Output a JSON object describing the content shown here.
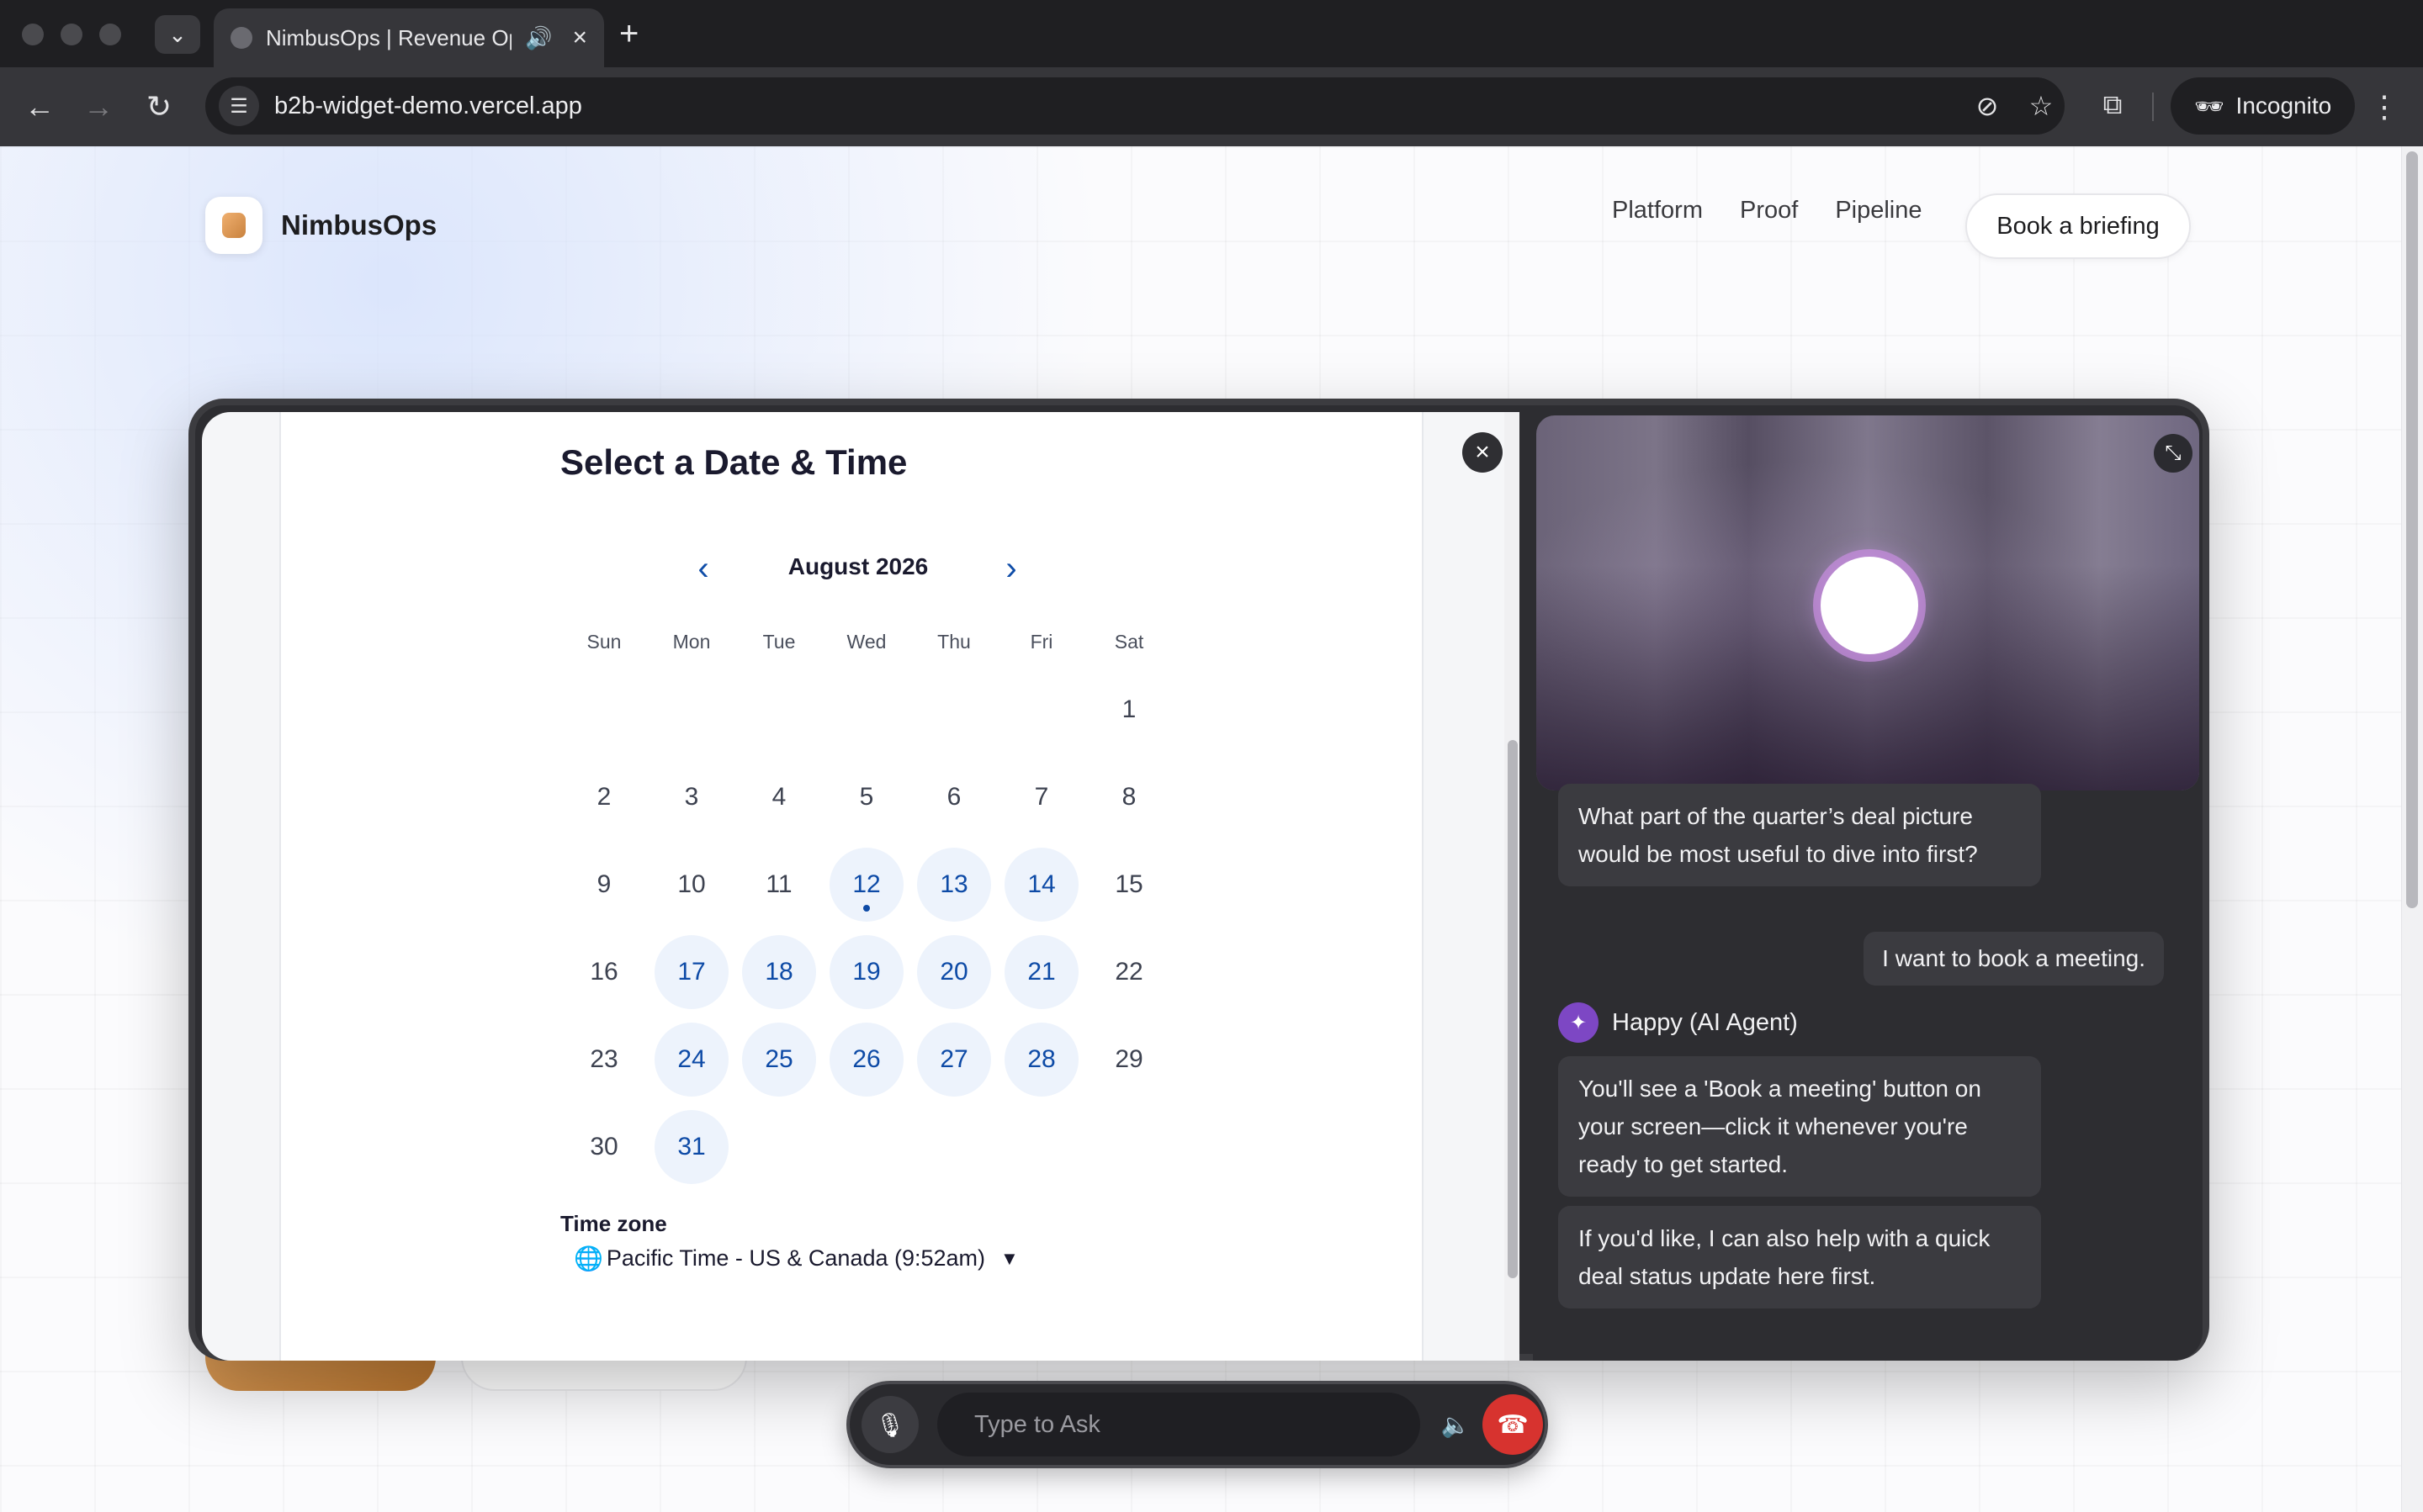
{
  "browser": {
    "tab_title": "NimbusOps | Revenue Op",
    "tab_audio_icon": "speaker-icon",
    "url": "b2b-widget-demo.vercel.app",
    "profile_label": "Incognito"
  },
  "site": {
    "brand_name": "NimbusOps",
    "nav": [
      {
        "label": "Platform"
      },
      {
        "label": "Proof"
      },
      {
        "label": "Pipeline"
      }
    ],
    "cta_label": "Book a briefing"
  },
  "calendar": {
    "title": "Select a Date & Time",
    "month_label": "August 2026",
    "weekdays": [
      "Sun",
      "Mon",
      "Tue",
      "Wed",
      "Thu",
      "Fri",
      "Sat"
    ],
    "first_weekday_index": 6,
    "days": [
      {
        "n": "1",
        "available": false
      },
      {
        "n": "2",
        "available": false
      },
      {
        "n": "3",
        "available": false
      },
      {
        "n": "4",
        "available": false
      },
      {
        "n": "5",
        "available": false
      },
      {
        "n": "6",
        "available": false
      },
      {
        "n": "7",
        "available": false
      },
      {
        "n": "8",
        "available": false
      },
      {
        "n": "9",
        "available": false
      },
      {
        "n": "10",
        "available": false
      },
      {
        "n": "11",
        "available": false
      },
      {
        "n": "12",
        "available": true,
        "today": true
      },
      {
        "n": "13",
        "available": true
      },
      {
        "n": "14",
        "available": true
      },
      {
        "n": "15",
        "available": false
      },
      {
        "n": "16",
        "available": false
      },
      {
        "n": "17",
        "available": true
      },
      {
        "n": "18",
        "available": true
      },
      {
        "n": "19",
        "available": true
      },
      {
        "n": "20",
        "available": true
      },
      {
        "n": "21",
        "available": true
      },
      {
        "n": "22",
        "available": false
      },
      {
        "n": "23",
        "available": false
      },
      {
        "n": "24",
        "available": true
      },
      {
        "n": "25",
        "available": true
      },
      {
        "n": "26",
        "available": true
      },
      {
        "n": "27",
        "available": true
      },
      {
        "n": "28",
        "available": true
      },
      {
        "n": "29",
        "available": false
      },
      {
        "n": "30",
        "available": false
      },
      {
        "n": "31",
        "available": true
      }
    ],
    "timezone_label": "Time zone",
    "timezone_value": "Pacific Time - US & Canada (9:52am)"
  },
  "assistant": {
    "messages_before": "What part of the quarter’s deal picture would be most useful to dive into first?",
    "user_message": "I want to book a meeting.",
    "agent_name": "Happy (AI Agent)",
    "reply_1": "You'll see a 'Book a meeting' button on your screen—click it whenever you're ready to get started.",
    "reply_2": "If you'd like, I can also help with a quick deal status update here first."
  },
  "voice_bar": {
    "input_placeholder": "Type to Ask"
  },
  "colors": {
    "accent_blue": "#0d4aa6",
    "available_day_bg": "#edf3fc",
    "agent_purple": "#7d47c4",
    "hangup_red": "#d7332f",
    "brand_orange": "#c9823e"
  }
}
